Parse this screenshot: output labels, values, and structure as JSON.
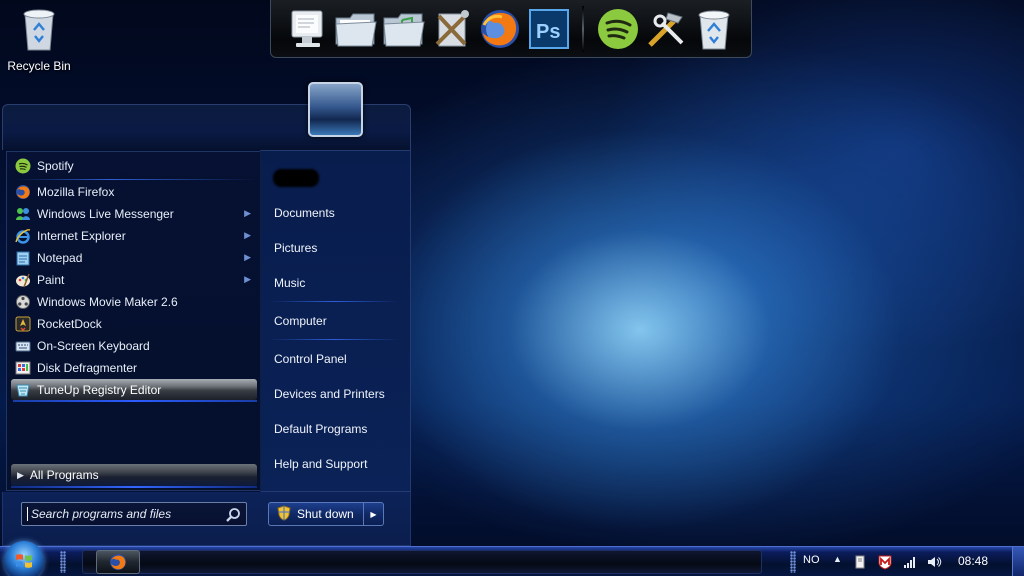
{
  "desktop": {
    "icons": [
      {
        "label": "Recycle Bin",
        "icon": "recycle-bin-icon"
      }
    ]
  },
  "dock": {
    "items": [
      {
        "name": "dock-item-computer",
        "icon": "computer-icon"
      },
      {
        "name": "dock-item-documents",
        "icon": "folder-icon"
      },
      {
        "name": "dock-item-music",
        "icon": "music-folder-icon"
      },
      {
        "name": "dock-item-tools",
        "icon": "tools-icon"
      },
      {
        "name": "dock-item-firefox",
        "icon": "firefox-icon"
      },
      {
        "name": "dock-item-photoshop",
        "icon": "photoshop-icon",
        "text": "Ps"
      },
      {
        "name": "dock-item-spotify",
        "icon": "spotify-icon"
      },
      {
        "name": "dock-item-settings",
        "icon": "wrench-hammer-icon"
      },
      {
        "name": "dock-item-recycle-bin",
        "icon": "recycle-bin-icon"
      }
    ]
  },
  "start_menu": {
    "pinned": [
      {
        "label": "Spotify",
        "icon": "spotify-icon"
      },
      {
        "label": "Mozilla Firefox",
        "icon": "firefox-icon"
      }
    ],
    "recent": [
      {
        "label": "Windows Live Messenger",
        "icon": "messenger-icon",
        "submenu": true
      },
      {
        "label": "Internet Explorer",
        "icon": "internet-explorer-icon",
        "submenu": true
      },
      {
        "label": "Notepad",
        "icon": "notepad-icon",
        "submenu": true
      },
      {
        "label": "Paint",
        "icon": "paint-icon",
        "submenu": true
      },
      {
        "label": "Windows Movie Maker 2.6",
        "icon": "movie-maker-icon",
        "submenu": false
      },
      {
        "label": "RocketDock",
        "icon": "rocketdock-icon",
        "submenu": false
      },
      {
        "label": "On-Screen Keyboard",
        "icon": "keyboard-icon",
        "submenu": false
      },
      {
        "label": "Disk Defragmenter",
        "icon": "defragmenter-icon",
        "submenu": false
      },
      {
        "label": "TuneUp Registry Editor",
        "icon": "registry-editor-icon",
        "submenu": false,
        "highlighted": true
      }
    ],
    "all_programs": "All Programs",
    "places": [
      "Documents",
      "Pictures",
      "Music",
      "Computer",
      "Control Panel",
      "Devices and Printers",
      "Default Programs",
      "Help and Support"
    ],
    "search_placeholder": "Search programs and files",
    "shutdown_label": "Shut down"
  },
  "taskbar": {
    "running": [
      {
        "icon": "firefox-icon"
      }
    ],
    "language": "NO",
    "tray_icons": [
      "show-hidden-icons-icon",
      "safely-remove-hardware-icon",
      "mcafee-icon",
      "network-signal-icon",
      "volume-icon"
    ],
    "clock": "08:48"
  },
  "colors": {
    "accent": "#2c5bff",
    "taskbar": "#0b1c5c",
    "menu_bg": "#061133"
  }
}
